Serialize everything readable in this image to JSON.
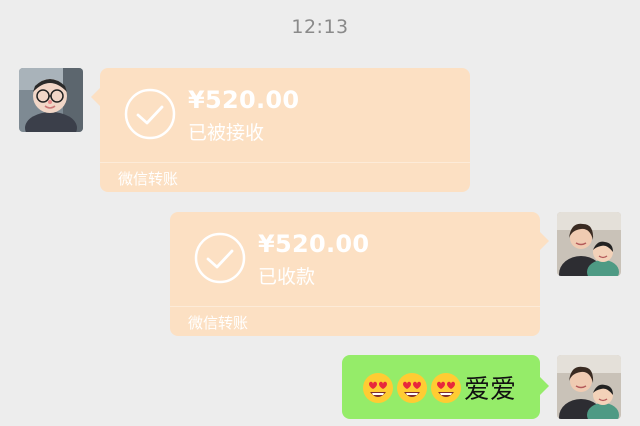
{
  "timestamp": "12:13",
  "messages": [
    {
      "side": "left",
      "type": "transfer",
      "amount": "¥520.00",
      "status": "已被接收",
      "footer": "微信转账",
      "avatar_icon": "child-photo-avatar"
    },
    {
      "side": "right",
      "type": "transfer",
      "amount": "¥520.00",
      "status": "已收款",
      "footer": "微信转账",
      "avatar_icon": "woman-child-photo-avatar"
    },
    {
      "side": "right",
      "type": "text",
      "emoji": [
        "heart-eyes-emoji",
        "heart-eyes-emoji",
        "heart-eyes-emoji"
      ],
      "text": "爱爱",
      "avatar_icon": "woman-child-photo-avatar"
    }
  ],
  "colors": {
    "background": "#ededed",
    "transfer_bubble": "#fce0c3",
    "text_bubble": "#95ec69",
    "timestamp": "#8a8a8a"
  }
}
